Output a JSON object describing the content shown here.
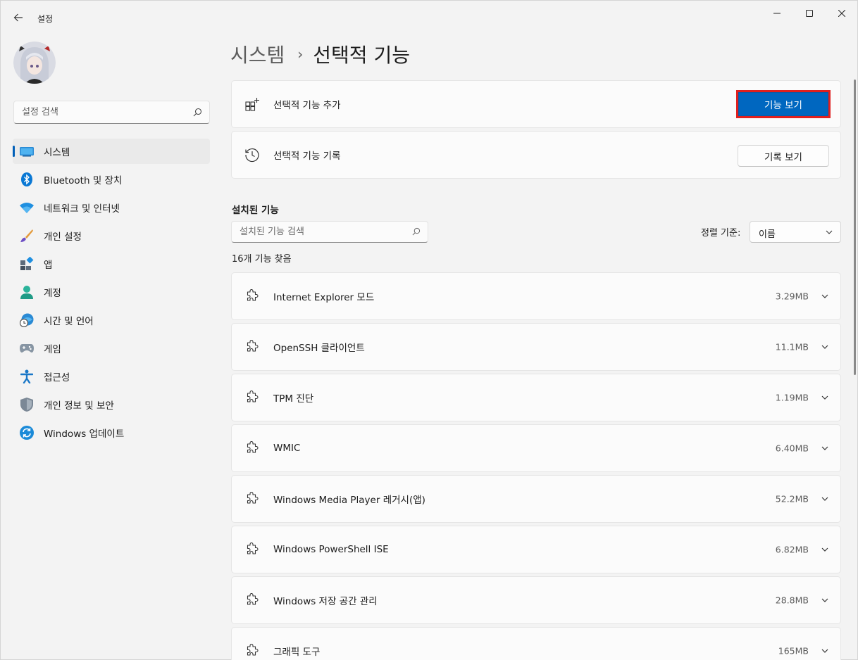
{
  "window": {
    "title": "설정",
    "minimize_icon": "minimize-icon",
    "maximize_icon": "maximize-icon",
    "close_icon": "close-icon"
  },
  "sidebar": {
    "search_placeholder": "설정 검색",
    "items": [
      {
        "label": "시스템",
        "icon": "system-icon",
        "selected": true
      },
      {
        "label": "Bluetooth 및 장치",
        "icon": "bluetooth-icon"
      },
      {
        "label": "네트워크 및 인터넷",
        "icon": "wifi-icon"
      },
      {
        "label": "개인 설정",
        "icon": "brush-icon"
      },
      {
        "label": "앱",
        "icon": "apps-icon"
      },
      {
        "label": "계정",
        "icon": "account-icon"
      },
      {
        "label": "시간 및 언어",
        "icon": "time-language-icon"
      },
      {
        "label": "게임",
        "icon": "gamepad-icon"
      },
      {
        "label": "접근성",
        "icon": "accessibility-icon"
      },
      {
        "label": "개인 정보 및 보안",
        "icon": "shield-icon"
      },
      {
        "label": "Windows 업데이트",
        "icon": "update-icon"
      }
    ]
  },
  "breadcrumb": {
    "parent": "시스템",
    "separator": "›",
    "current": "선택적 기능"
  },
  "add_feature": {
    "label": "선택적 기능 추가",
    "button": "기능 보기"
  },
  "history": {
    "label": "선택적 기능 기록",
    "button": "기록 보기"
  },
  "installed": {
    "title": "설치된 기능",
    "search_placeholder": "설치된 기능 검색",
    "sort_label": "정렬 기준:",
    "sort_value": "이름",
    "count_text": "16개 기능 찾음",
    "features": [
      {
        "name": "Internet Explorer 모드",
        "size": "3.29MB"
      },
      {
        "name": "OpenSSH 클라이언트",
        "size": "11.1MB"
      },
      {
        "name": "TPM 진단",
        "size": "1.19MB"
      },
      {
        "name": "WMIC",
        "size": "6.40MB"
      },
      {
        "name": "Windows Media Player 레거시(앱)",
        "size": "52.2MB"
      },
      {
        "name": "Windows PowerShell ISE",
        "size": "6.82MB"
      },
      {
        "name": "Windows 저장 공간 관리",
        "size": "28.8MB"
      },
      {
        "name": "그래픽 도구",
        "size": "165MB"
      }
    ]
  },
  "colors": {
    "accent": "#0067c0",
    "highlight_border": "#e0201f"
  }
}
